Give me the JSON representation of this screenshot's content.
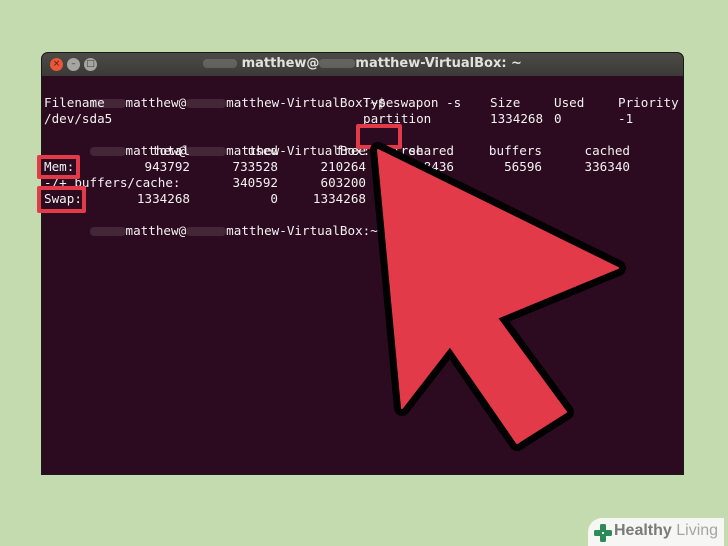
{
  "window": {
    "title_user": "matthew@",
    "title_host": "matthew-VirtualBox: ~",
    "close_glyph": "×",
    "min_glyph": "–",
    "max_glyph": "□"
  },
  "prompt": {
    "user": "matthew@",
    "host": "matthew-VirtualBox:~$"
  },
  "commands": [
    "swapon -s",
    "free"
  ],
  "swapon": {
    "headers": [
      "Filename",
      "Type",
      "Size",
      "Used",
      "Priority"
    ],
    "row": [
      "/dev/sda5",
      "partition",
      "1334268",
      "0",
      "-1"
    ]
  },
  "free": {
    "headers": [
      "total",
      "used",
      "free",
      "shared",
      "buffers",
      "cached"
    ],
    "mem": {
      "label": "Mem:",
      "values": [
        "943792",
        "733528",
        "210264",
        "8436",
        "56596",
        "336340"
      ]
    },
    "buffers": {
      "label": "-/+ buffers/cache:",
      "values": [
        "340592",
        "603200"
      ]
    },
    "swap": {
      "label": "Swap:",
      "values": [
        "1334268",
        "0",
        "1334268"
      ]
    }
  },
  "watermark": {
    "word1": "Healthy",
    "word2": "Living"
  },
  "colors": {
    "highlight": "#e23a48",
    "terminal_bg": "#2c0a1f",
    "page_bg": "#c4dbb0"
  }
}
